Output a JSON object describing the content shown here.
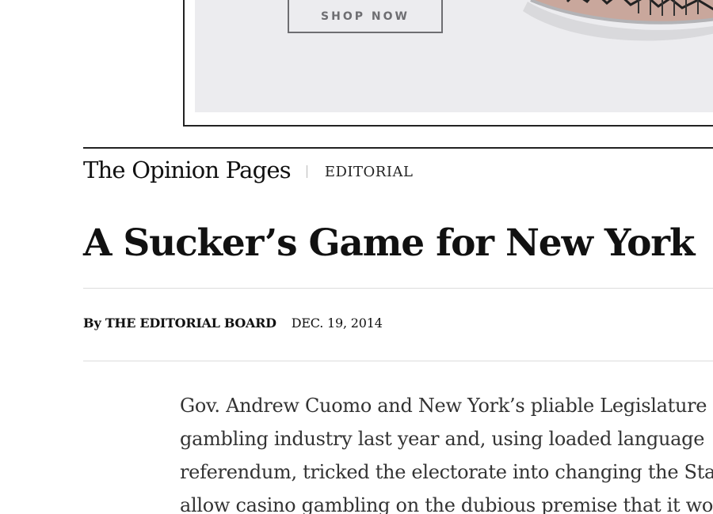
{
  "ad": {
    "button_label": "SHOP NOW",
    "product_icon": "shoe-image"
  },
  "section": {
    "name": "The Opinion Pages",
    "kicker": "EDITORIAL"
  },
  "article": {
    "headline": "A Sucker’s Game for New York",
    "byline_prefix": "By",
    "byline_author": "THE EDITORIAL BOARD",
    "date": "DEC. 19, 2014",
    "body_lines": [
      "Gov. Andrew Cuomo and New York’s pliable Legislature",
      "gambling industry last year and, using loaded language",
      "referendum, tricked the electorate into changing the Sta",
      "allow casino gambling on the dubious premise that it wo"
    ]
  },
  "colors": {
    "ad_background": "#ececef",
    "ad_button": "#6e6e72",
    "rule_dark": "#222222",
    "rule_light": "#dcdcdc",
    "body_text": "#333333"
  }
}
